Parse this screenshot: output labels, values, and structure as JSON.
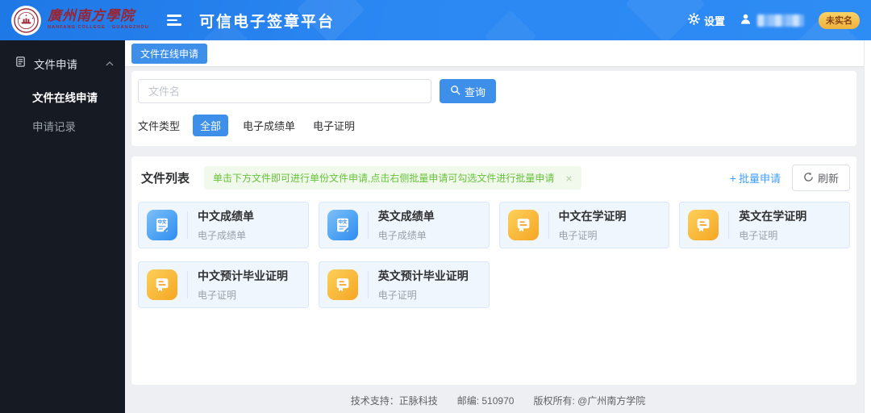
{
  "header": {
    "school_name": "廣州南方學院",
    "school_subtitle": "NANFANG COLLEGE · GUANGZHOU",
    "app_title": "可信电子签章平台",
    "settings_label": "设置",
    "realname_badge": "未实名"
  },
  "sidebar": {
    "group_label": "文件申请",
    "items": [
      {
        "label": "文件在线申请",
        "active": true
      },
      {
        "label": "申请记录",
        "active": false
      }
    ]
  },
  "tab_label": "文件在线申请",
  "search": {
    "placeholder": "文件名",
    "query_button": "查询"
  },
  "filter": {
    "label": "文件类型",
    "options": [
      {
        "label": "全部",
        "selected": true
      },
      {
        "label": "电子成绩单",
        "selected": false
      },
      {
        "label": "电子证明",
        "selected": false
      }
    ]
  },
  "file_list": {
    "title": "文件列表",
    "notice": "单击下方文件即可进行单份文件申请,点击右侧批量申请可勾选文件进行批量申请",
    "batch_label": "批量申请",
    "refresh_label": "刷新",
    "cards": [
      {
        "title": "中文成绩单",
        "type": "电子成绩单",
        "icon": "transcript-blue"
      },
      {
        "title": "英文成绩单",
        "type": "电子成绩单",
        "icon": "transcript-blue"
      },
      {
        "title": "中文在学证明",
        "type": "电子证明",
        "icon": "certificate-yellow"
      },
      {
        "title": "英文在学证明",
        "type": "电子证明",
        "icon": "certificate-yellow"
      },
      {
        "title": "中文预计毕业证明",
        "type": "电子证明",
        "icon": "certificate-yellow"
      },
      {
        "title": "英文预计毕业证明",
        "type": "电子证明",
        "icon": "certificate-yellow"
      }
    ]
  },
  "footer": {
    "support": "技术支持：正脉科技",
    "postcode": "邮编: 510970",
    "copyright": "版权所有: @广州南方学院"
  },
  "glyphs": {
    "close": "×",
    "plus": "+"
  },
  "colors": {
    "accent": "#3d8fea",
    "success": "#67c23a",
    "badge": "#efb23e",
    "card_bg": "#f0f6fd",
    "sidebar_bg": "#151a23"
  }
}
